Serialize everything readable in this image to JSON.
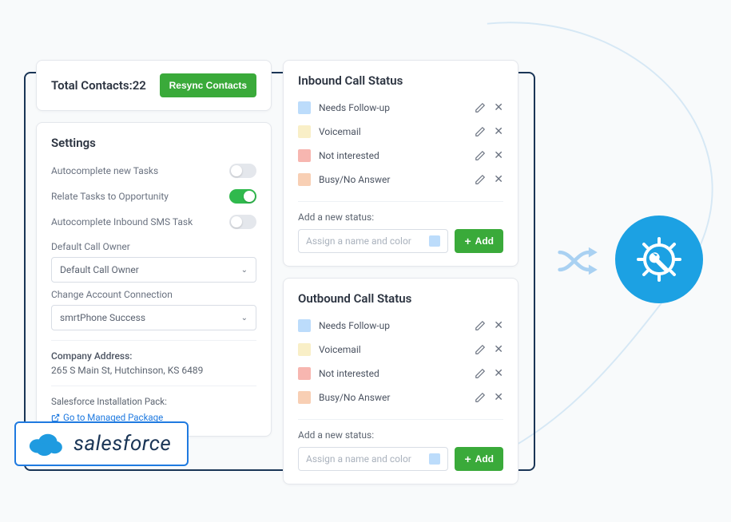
{
  "contacts": {
    "label": "Total Contacts:",
    "count": "22",
    "resync_label": "Resync Contacts"
  },
  "settings": {
    "title": "Settings",
    "toggles": [
      {
        "label": "Autocomplete new Tasks",
        "on": false
      },
      {
        "label": "Relate Tasks to Opportunity",
        "on": true
      },
      {
        "label": "Autocomplete Inbound SMS Task",
        "on": false
      }
    ],
    "default_owner_label": "Default Call Owner",
    "default_owner_value": "Default Call Owner",
    "account_conn_label": "Change Account Connection",
    "account_conn_value": "smrtPhone Success",
    "address_label": "Company Address:",
    "address_value": "265 S Main St, Hutchinson, KS 6489",
    "install_label": "Salesforce Installation Pack:",
    "install_link": "Go to Managed Package"
  },
  "inbound": {
    "title": "Inbound Call Status",
    "statuses": [
      {
        "label": "Needs Follow-up",
        "color": "#bcdcfb"
      },
      {
        "label": "Voicemail",
        "color": "#f9efc7"
      },
      {
        "label": "Not interested",
        "color": "#f7b6b0"
      },
      {
        "label": "Busy/No Answer",
        "color": "#f8cfb4"
      }
    ],
    "add_label": "Add a new status:",
    "add_placeholder": "Assign a name and color",
    "add_button": "Add"
  },
  "outbound": {
    "title": "Outbound Call Status",
    "statuses": [
      {
        "label": "Needs Follow-up",
        "color": "#bcdcfb"
      },
      {
        "label": "Voicemail",
        "color": "#f9efc7"
      },
      {
        "label": "Not interested",
        "color": "#f7b6b0"
      },
      {
        "label": "Busy/No Answer",
        "color": "#f8cfb4"
      }
    ],
    "add_label": "Add a new status:",
    "add_placeholder": "Assign a name and color",
    "add_button": "Add"
  },
  "badge": {
    "text": "salesforce"
  }
}
